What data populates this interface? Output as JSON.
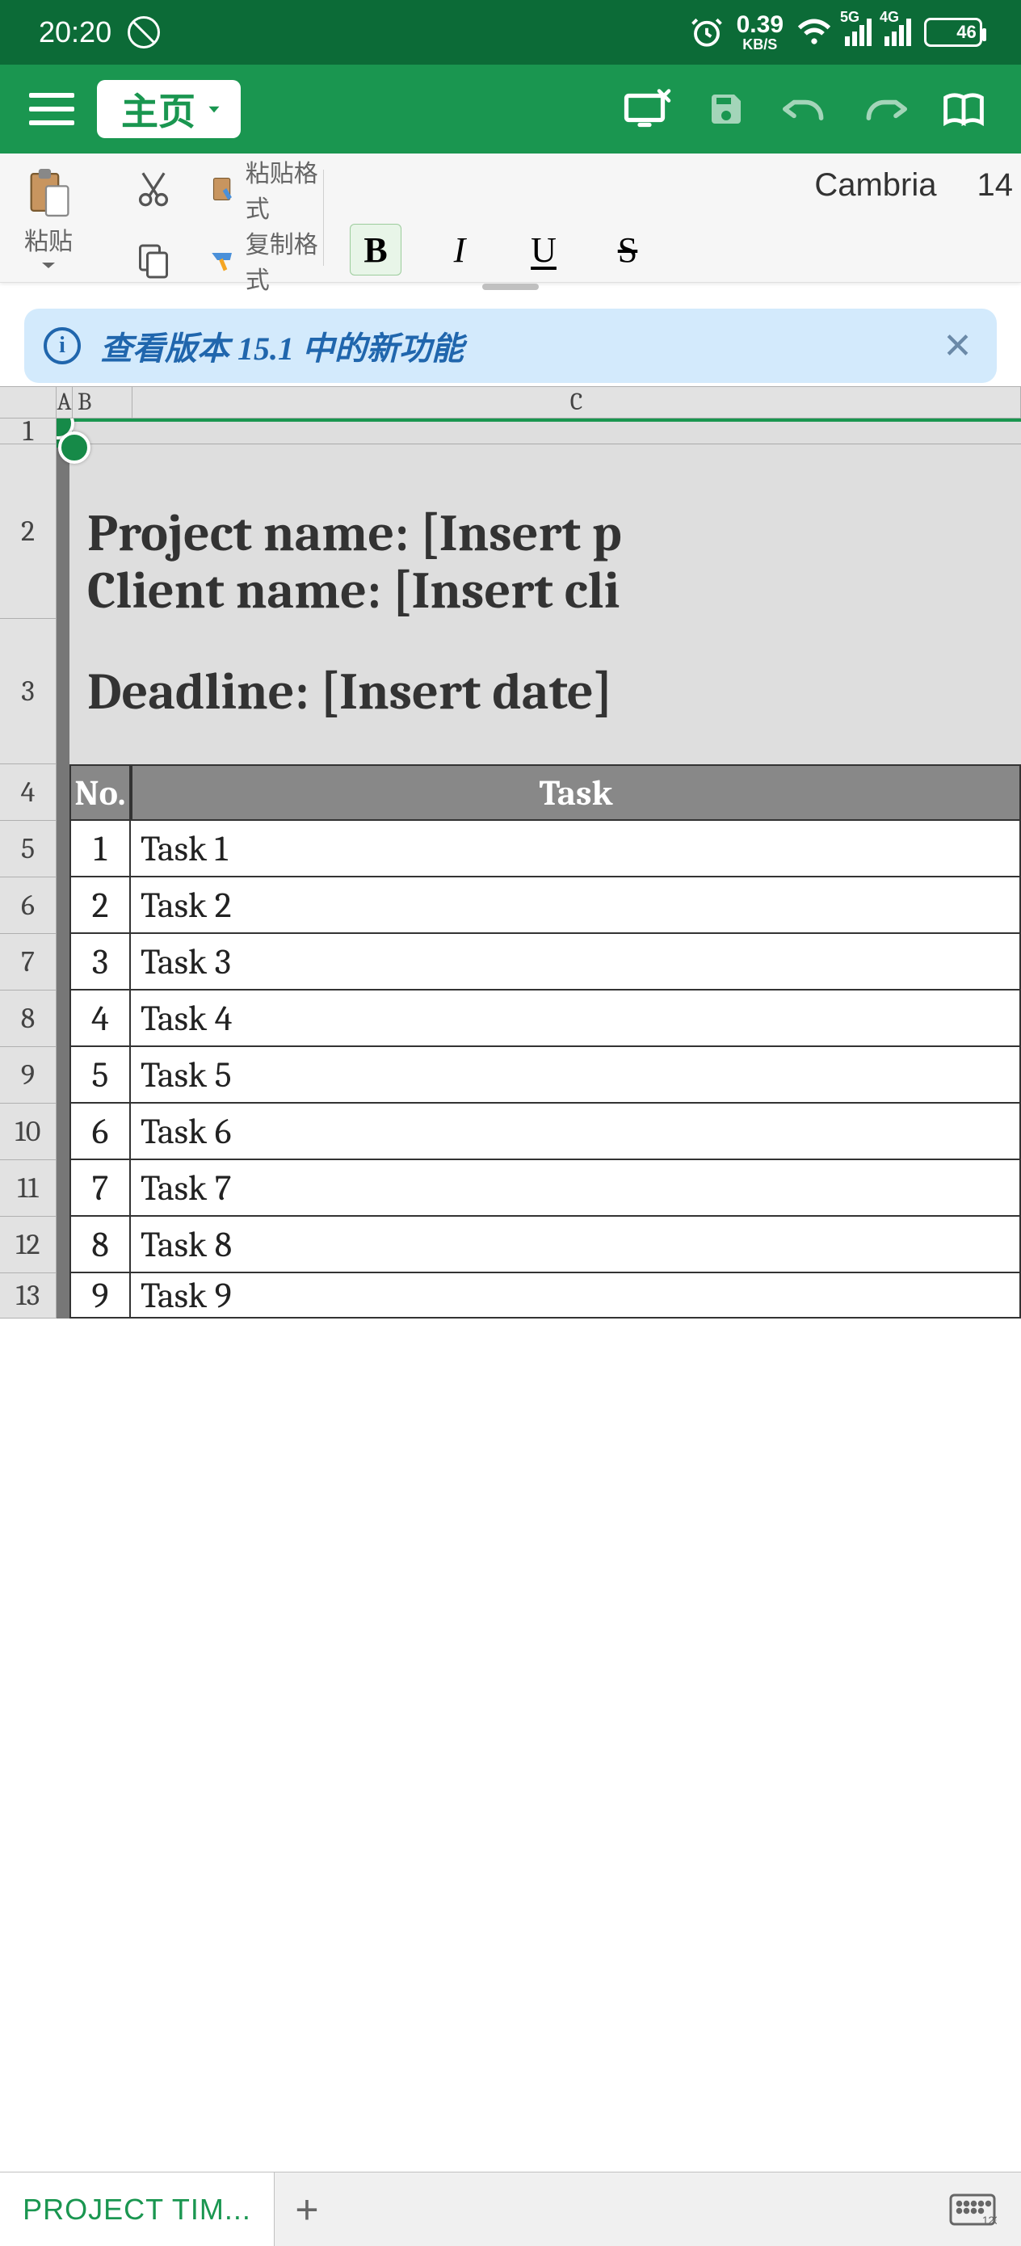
{
  "status": {
    "time": "20:20",
    "speed_val": "0.39",
    "speed_unit": "KB/S",
    "net1": "5G",
    "net2": "4G",
    "battery": "46"
  },
  "titlebar": {
    "tab_label": "主页"
  },
  "ribbon": {
    "paste": "粘贴",
    "paste_format": "粘贴格式",
    "copy_format": "复制格式",
    "font_name": "Cambria",
    "font_size": "14",
    "bold": "B",
    "italic": "I",
    "underline": "U",
    "strike": "S"
  },
  "banner": {
    "text": "查看版本 15.1 中的新功能"
  },
  "columns": {
    "a": "A",
    "b": "B",
    "c": "C"
  },
  "rows": [
    "1",
    "2",
    "3",
    "4",
    "5",
    "6",
    "7",
    "8",
    "9",
    "10",
    "11",
    "12",
    "13"
  ],
  "doc": {
    "project_line": "Project name: [Insert p",
    "client_line": "Client name: [Insert cli",
    "deadline_line": "Deadline: [Insert date]",
    "header_no": "No.",
    "header_task": "Task",
    "tasks": [
      {
        "no": "1",
        "name": "Task 1"
      },
      {
        "no": "2",
        "name": "Task 2"
      },
      {
        "no": "3",
        "name": "Task 3"
      },
      {
        "no": "4",
        "name": "Task 4"
      },
      {
        "no": "5",
        "name": "Task 5"
      },
      {
        "no": "6",
        "name": "Task 6"
      },
      {
        "no": "7",
        "name": "Task 7"
      },
      {
        "no": "8",
        "name": "Task 8"
      },
      {
        "no": "9",
        "name": "Task 9"
      }
    ]
  },
  "bottom": {
    "sheet_name": "PROJECT TIM...",
    "add": "+"
  }
}
